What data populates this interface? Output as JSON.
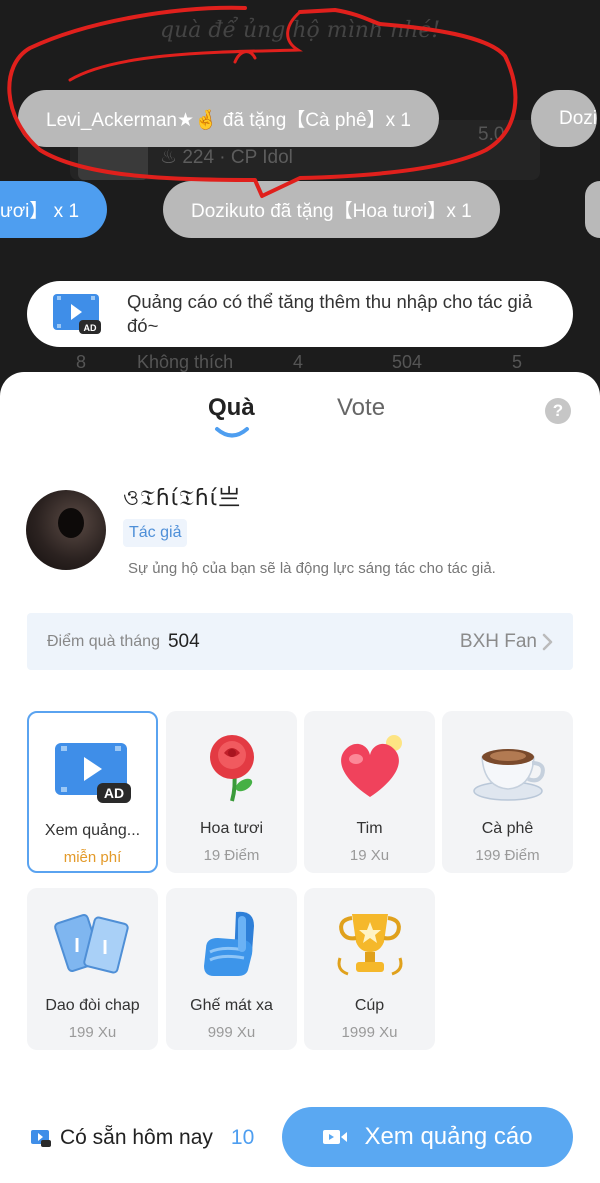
{
  "background": {
    "header_text": "quà để ủng hộ mình nhé!",
    "story_stats": "224 · CP Idol",
    "story_score": "5.0",
    "table_row": [
      "8",
      "Không thích",
      "4",
      "504",
      "5"
    ]
  },
  "gift_feed": [
    {
      "text": "Levi_Ackerman★🤞 đã tặng【Cà phê】x 1"
    },
    {
      "text": "Dozi"
    },
    {
      "text": "ươi】 x 1"
    },
    {
      "text": "Dozikuto đã tặng【Hoa tươi】x 1"
    }
  ],
  "ad_banner": {
    "text": "Quảng cáo có thể tăng thêm thu nhập cho tác giả đó~",
    "icon": "ad-video-icon"
  },
  "tabs": [
    {
      "label": "Quà",
      "active": true
    },
    {
      "label": "Vote",
      "active": false
    }
  ],
  "help_icon": "?",
  "author": {
    "name": "ও𝔗ɦί𝔗ɦί亗",
    "role": "Tác giả",
    "subtitle": "Sự ủng hộ của bạn sẽ là động lực sáng tác cho tác giả."
  },
  "points": {
    "label": "Điểm quà tháng",
    "value": "504",
    "fan_link": "BXH Fan"
  },
  "gifts": [
    {
      "name": "Xem quảng...",
      "price": "miễn phí",
      "icon": "ad-video-icon",
      "selected": true
    },
    {
      "name": "Hoa tươi",
      "price": "19 Điểm",
      "icon": "rose-icon",
      "selected": false
    },
    {
      "name": "Tim",
      "price": "19 Xu",
      "icon": "heart-icon",
      "selected": false
    },
    {
      "name": "Cà phê",
      "price": "199 Điểm",
      "icon": "coffee-cup-icon",
      "selected": false
    },
    {
      "name": "Dao đòi chap",
      "price": "199 Xu",
      "icon": "knife-tickets-icon",
      "selected": false
    },
    {
      "name": "Ghế mát xa",
      "price": "999 Xu",
      "icon": "massage-chair-icon",
      "selected": false
    },
    {
      "name": "Cúp",
      "price": "1999 Xu",
      "icon": "trophy-icon",
      "selected": false
    }
  ],
  "footer": {
    "available_label": "Có sẵn hôm nay",
    "available_count": "10",
    "watch_button": "Xem quảng cáo"
  },
  "colors": {
    "accent": "#5aa8f2",
    "free_price": "#e39a2a",
    "chip_gray": "#b9b9b9",
    "chip_blue": "#4e9ef0",
    "annotation_red": "#e0201c"
  }
}
